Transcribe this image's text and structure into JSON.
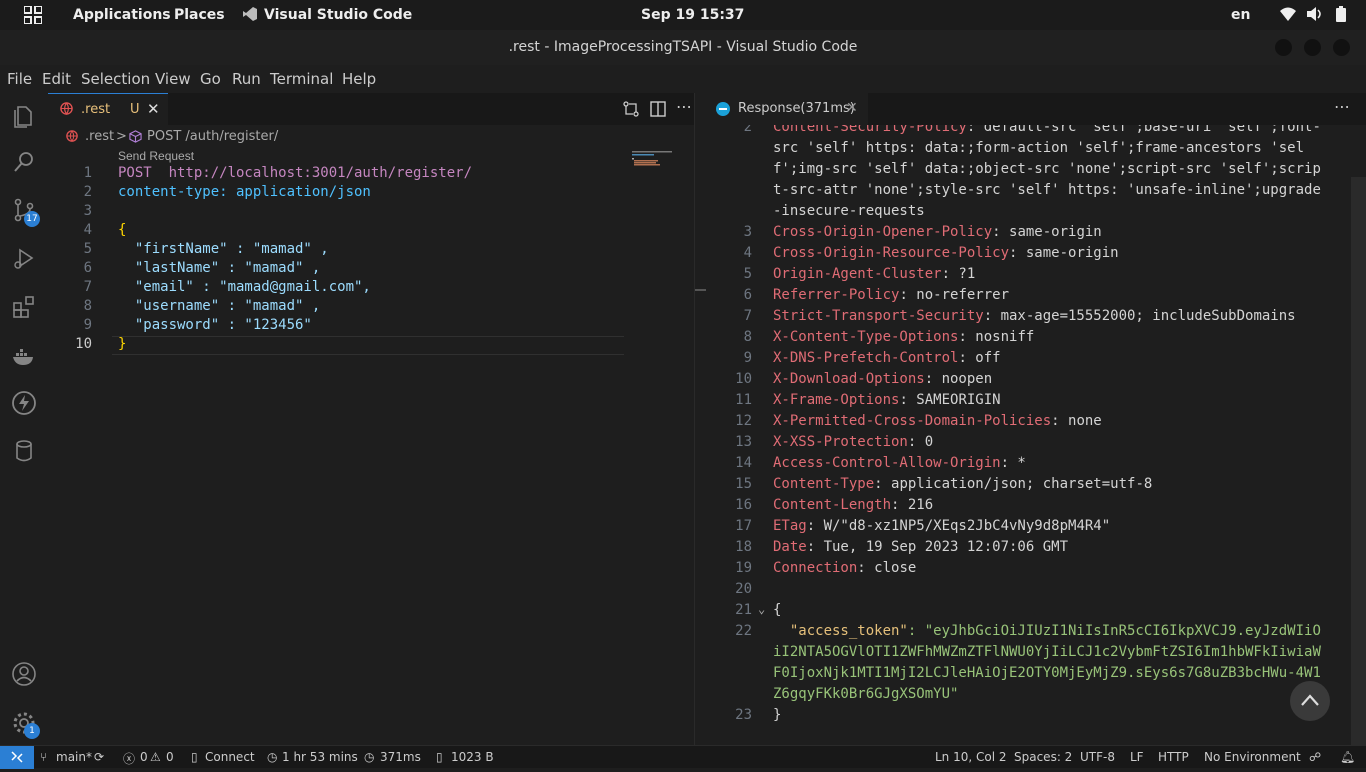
{
  "system": {
    "applications": "Applications",
    "places": "Places",
    "vscode": "Visual Studio Code",
    "datetime": "Sep 19  15:37",
    "lang": "en"
  },
  "window": {
    "title": ".rest - ImageProcessingTSAPI - Visual Studio Code"
  },
  "menu": [
    "File",
    "Edit",
    "Selection",
    "View",
    "Go",
    "Run",
    "Terminal",
    "Help"
  ],
  "activity": {
    "scm_badge": "17",
    "settings_badge": "1"
  },
  "editor": {
    "tab_label": ".rest",
    "tab_status": "U",
    "breadcrumb_file": ".rest",
    "breadcrumb_sep": ">",
    "breadcrumb_symbol": "POST /auth/register/",
    "send_request": "Send Request",
    "lines": [
      {
        "n": "1",
        "text": "POST  http://localhost:3001/auth/register/"
      },
      {
        "n": "2",
        "text": "content-type: application/json"
      },
      {
        "n": "3",
        "text": ""
      },
      {
        "n": "4",
        "text": "{"
      },
      {
        "n": "5",
        "text": "  \"firstName\" : \"mamad\" ,"
      },
      {
        "n": "6",
        "text": "  \"lastName\" : \"mamad\" ,"
      },
      {
        "n": "7",
        "text": "  \"email\" : \"mamad@gmail.com\","
      },
      {
        "n": "8",
        "text": "  \"username\" : \"mamad\" ,"
      },
      {
        "n": "9",
        "text": "  \"password\" : \"123456\""
      },
      {
        "n": "10",
        "text": "}"
      }
    ]
  },
  "response": {
    "tab_label": "Response(371ms)",
    "lines": [
      {
        "n": "2",
        "k": "Content-Security-Policy",
        "v": ": default-src 'self';base-uri 'self';font-"
      },
      {
        "n": "",
        "k": "",
        "v": "src 'self' https: data:;form-action 'self';frame-ancestors 'sel"
      },
      {
        "n": "",
        "k": "",
        "v": "f';img-src 'self' data:;object-src 'none';script-src 'self';scrip"
      },
      {
        "n": "",
        "k": "",
        "v": "t-src-attr 'none';style-src 'self' https: 'unsafe-inline';upgrade"
      },
      {
        "n": "",
        "k": "",
        "v": "-insecure-requests"
      },
      {
        "n": "3",
        "k": "Cross-Origin-Opener-Policy",
        "v": ": same-origin"
      },
      {
        "n": "4",
        "k": "Cross-Origin-Resource-Policy",
        "v": ": same-origin"
      },
      {
        "n": "5",
        "k": "Origin-Agent-Cluster",
        "v": ": ?1"
      },
      {
        "n": "6",
        "k": "Referrer-Policy",
        "v": ": no-referrer"
      },
      {
        "n": "7",
        "k": "Strict-Transport-Security",
        "v": ": max-age=15552000; includeSubDomains"
      },
      {
        "n": "8",
        "k": "X-Content-Type-Options",
        "v": ": nosniff"
      },
      {
        "n": "9",
        "k": "X-DNS-Prefetch-Control",
        "v": ": off"
      },
      {
        "n": "10",
        "k": "X-Download-Options",
        "v": ": noopen"
      },
      {
        "n": "11",
        "k": "X-Frame-Options",
        "v": ": SAMEORIGIN"
      },
      {
        "n": "12",
        "k": "X-Permitted-Cross-Domain-Policies",
        "v": ": none"
      },
      {
        "n": "13",
        "k": "X-XSS-Protection",
        "v": ": 0"
      },
      {
        "n": "14",
        "k": "Access-Control-Allow-Origin",
        "v": ": *"
      },
      {
        "n": "15",
        "k": "Content-Type",
        "v": ": application/json; charset=utf-8"
      },
      {
        "n": "16",
        "k": "Content-Length",
        "v": ": 216"
      },
      {
        "n": "17",
        "k": "ETag",
        "v": ": W/\"d8-xz1NP5/XEqs2JbC4vNy9d8pM4R4\""
      },
      {
        "n": "18",
        "k": "Date",
        "v": ": Tue, 19 Sep 2023 12:07:06 GMT"
      },
      {
        "n": "19",
        "k": "Connection",
        "v": ": close"
      },
      {
        "n": "20",
        "k": "",
        "v": ""
      },
      {
        "n": "21",
        "k": "",
        "v": "{"
      },
      {
        "n": "22",
        "k": "  \"access_token\"",
        "v": ": \"eyJhbGciOiJIUzI1NiIsInR5cCI6IkpXVCJ9.eyJzdWIiO"
      },
      {
        "n": "",
        "k": "",
        "v": "iI2NTA5OGVlOTI1ZWFhMWZmZTFlNWU0YjIiLCJ1c2VybmFtZSI6Im1hbWFkIiwiaW"
      },
      {
        "n": "",
        "k": "",
        "v": "F0IjoxNjk1MTI1MjI2LCJleHAiOjE2OTY0MjEyMjZ9.sEys6s7G8uZB3bcHWu-4W1"
      },
      {
        "n": "",
        "k": "",
        "v": "Z6gqyFKk0Br6GJgXSOmYU\""
      },
      {
        "n": "23",
        "k": "",
        "v": "}"
      }
    ]
  },
  "status": {
    "branch": "main*",
    "errors": "0",
    "warnings": "0",
    "connect": "Connect",
    "time": "1 hr 53 mins",
    "resp_time": "371ms",
    "size": "1023 B",
    "position": "Ln 10, Col 2",
    "spaces": "Spaces: 2",
    "encoding": "UTF-8",
    "eol": "LF",
    "lang": "HTTP",
    "env": "No Environment"
  }
}
